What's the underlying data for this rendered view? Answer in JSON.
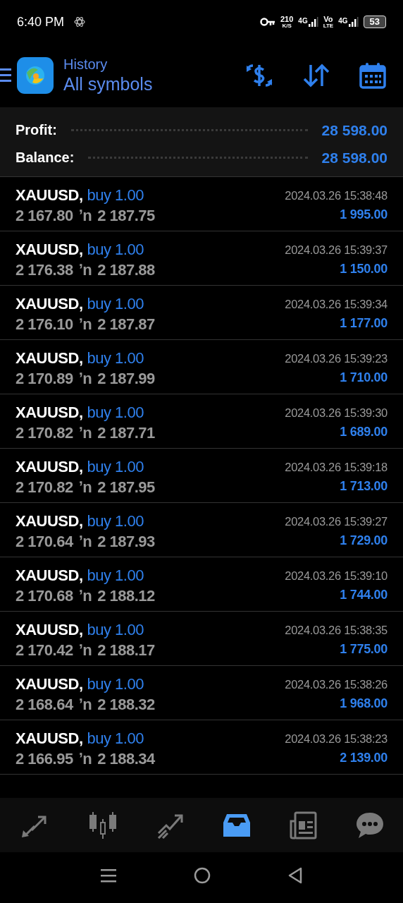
{
  "status_bar": {
    "time": "6:40 PM",
    "speed": "210",
    "speed_unit": "K/S",
    "sim1": "4G",
    "volte_top": "Vo",
    "volte_bottom": "LTE",
    "sim2": "4G",
    "battery": "53"
  },
  "header": {
    "title": "History",
    "subtitle": "All symbols"
  },
  "summary": [
    {
      "label": "Profit:",
      "value": "28 598.00"
    },
    {
      "label": "Balance:",
      "value": "28 598.00"
    }
  ],
  "deals": [
    {
      "symbol": "XAUUSD,",
      "side": "buy 1.00",
      "open": "2 167.80",
      "arrow": "ʼn",
      "close": "2 187.75",
      "time": "2024.03.26 15:38:48",
      "profit": "1 995.00"
    },
    {
      "symbol": "XAUUSD,",
      "side": "buy 1.00",
      "open": "2 176.38",
      "arrow": "ʼn",
      "close": "2 187.88",
      "time": "2024.03.26 15:39:37",
      "profit": "1 150.00"
    },
    {
      "symbol": "XAUUSD,",
      "side": "buy 1.00",
      "open": "2 176.10",
      "arrow": "ʼn",
      "close": "2 187.87",
      "time": "2024.03.26 15:39:34",
      "profit": "1 177.00"
    },
    {
      "symbol": "XAUUSD,",
      "side": "buy 1.00",
      "open": "2 170.89",
      "arrow": "ʼn",
      "close": "2 187.99",
      "time": "2024.03.26 15:39:23",
      "profit": "1 710.00"
    },
    {
      "symbol": "XAUUSD,",
      "side": "buy 1.00",
      "open": "2 170.82",
      "arrow": "ʼn",
      "close": "2 187.71",
      "time": "2024.03.26 15:39:30",
      "profit": "1 689.00"
    },
    {
      "symbol": "XAUUSD,",
      "side": "buy 1.00",
      "open": "2 170.82",
      "arrow": "ʼn",
      "close": "2 187.95",
      "time": "2024.03.26 15:39:18",
      "profit": "1 713.00"
    },
    {
      "symbol": "XAUUSD,",
      "side": "buy 1.00",
      "open": "2 170.64",
      "arrow": "ʼn",
      "close": "2 187.93",
      "time": "2024.03.26 15:39:27",
      "profit": "1 729.00"
    },
    {
      "symbol": "XAUUSD,",
      "side": "buy 1.00",
      "open": "2 170.68",
      "arrow": "ʼn",
      "close": "2 188.12",
      "time": "2024.03.26 15:39:10",
      "profit": "1 744.00"
    },
    {
      "symbol": "XAUUSD,",
      "side": "buy 1.00",
      "open": "2 170.42",
      "arrow": "ʼn",
      "close": "2 188.17",
      "time": "2024.03.26 15:38:35",
      "profit": "1 775.00"
    },
    {
      "symbol": "XAUUSD,",
      "side": "buy 1.00",
      "open": "2 168.64",
      "arrow": "ʼn",
      "close": "2 188.32",
      "time": "2024.03.26 15:38:26",
      "profit": "1 968.00"
    },
    {
      "symbol": "XAUUSD,",
      "side": "buy 1.00",
      "open": "2 166.95",
      "arrow": "ʼn",
      "close": "2 188.34",
      "time": "2024.03.26 15:38:23",
      "profit": "2 139.00"
    }
  ],
  "nav_tabs": [
    {
      "kind": "trade",
      "selected": false
    },
    {
      "kind": "chart",
      "selected": false
    },
    {
      "kind": "trades",
      "selected": false
    },
    {
      "kind": "history",
      "selected": true
    },
    {
      "kind": "news",
      "selected": false
    },
    {
      "kind": "chat",
      "selected": false
    }
  ]
}
